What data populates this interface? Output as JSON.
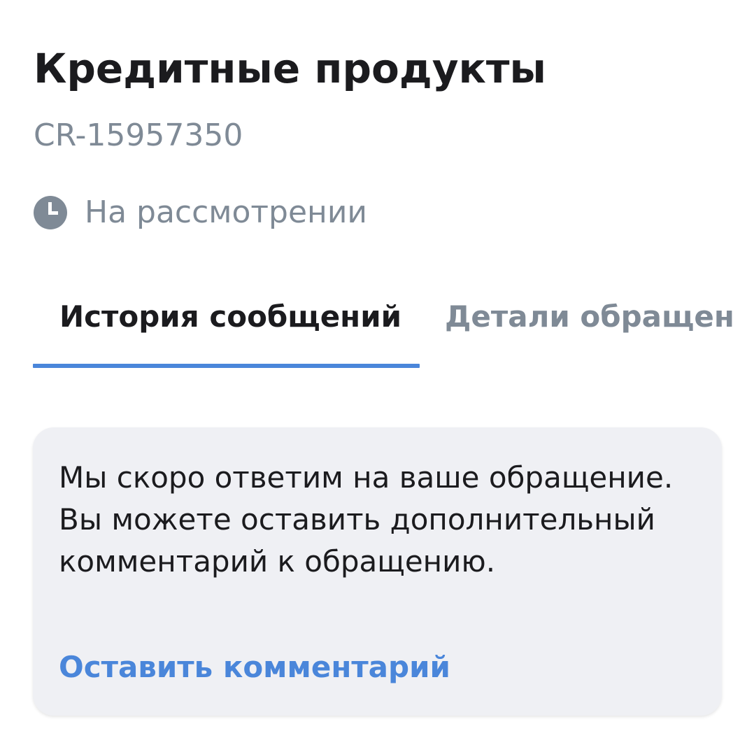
{
  "header": {
    "title": "Кредитные продукты",
    "request_id": "CR-15957350"
  },
  "status": {
    "icon": "clock-icon",
    "label": "На рассмотрении",
    "color": "#7f8a96"
  },
  "tabs": [
    {
      "label": "История сообщений",
      "active": true
    },
    {
      "label": "Детали обращен",
      "active": false
    }
  ],
  "message_card": {
    "text": "Мы скоро ответим на ваше обращение. Вы можете оставить дополнительный комментарий к обращению.",
    "link_label": "Оставить комментарий"
  },
  "colors": {
    "accent": "#4a86da",
    "text_primary": "#1b1b1e",
    "text_secondary": "#7f8a96",
    "card_background": "#eff0f4"
  }
}
